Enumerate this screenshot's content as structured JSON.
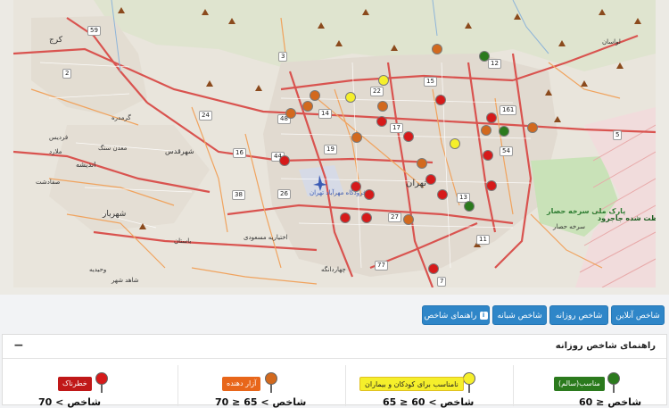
{
  "map": {
    "cities": [
      {
        "name": "کرج"
      },
      {
        "name": "تهران"
      },
      {
        "name": "شهریار"
      },
      {
        "name": "اندیشه"
      },
      {
        "name": "شهرقدس"
      },
      {
        "name": "ملارد"
      },
      {
        "name": "فردیس"
      },
      {
        "name": "گرمدره"
      },
      {
        "name": "صفادشت"
      },
      {
        "name": "باستان"
      },
      {
        "name": "وحیدیه"
      },
      {
        "name": "شاهد شهر"
      },
      {
        "name": "چهاردانگه"
      },
      {
        "name": "لواسان"
      },
      {
        "name": "فرودگاه مهرآباد تهران"
      },
      {
        "name": "اختیاریه مسعودی"
      },
      {
        "name": "معدن سنگ"
      },
      {
        "name": "سرخه حصار"
      }
    ],
    "areas": {
      "park": "پارک ملی سرخه حصار",
      "protected": "منطقه حفاظت شده جاجرود"
    },
    "route_shields": [
      "59",
      "2",
      "3",
      "5",
      "12",
      "15",
      "161",
      "54",
      "22",
      "14",
      "24",
      "48",
      "17",
      "19",
      "16",
      "44",
      "26",
      "38",
      "13",
      "27",
      "11",
      "77",
      "7"
    ],
    "station_colors": {
      "green": "#2b7a1d",
      "yellow": "#f5ef2b",
      "orange": "#d2691e",
      "red": "#d61a1a"
    }
  },
  "tabs": [
    {
      "label": "شاخص آنلاین"
    },
    {
      "label": "شاخص روزانه"
    },
    {
      "label": "شاخص شبانه"
    },
    {
      "label": "راهنمای شاخص"
    }
  ],
  "panel": {
    "title": "راهنمای شاخص روزانه",
    "collapse": "−",
    "legend": [
      {
        "label": "مناسب(سالم)",
        "value": "60 ≥ شاخص",
        "color": "#2b7a1d",
        "text_color": "#ffffff"
      },
      {
        "label": "نامناسب برای کودکان و بیماران",
        "value": "65 ≥ شاخص > 60",
        "color": "#f5ef2b",
        "text_color": "#222222"
      },
      {
        "label": "آزار دهنده",
        "value": "70 ≥ شاخص > 65",
        "color": "#e8661a",
        "text_color": "#ffffff"
      },
      {
        "label": "خطرناک",
        "value": "70 < شاخص",
        "color": "#c01818",
        "text_color": "#ffffff"
      }
    ]
  }
}
